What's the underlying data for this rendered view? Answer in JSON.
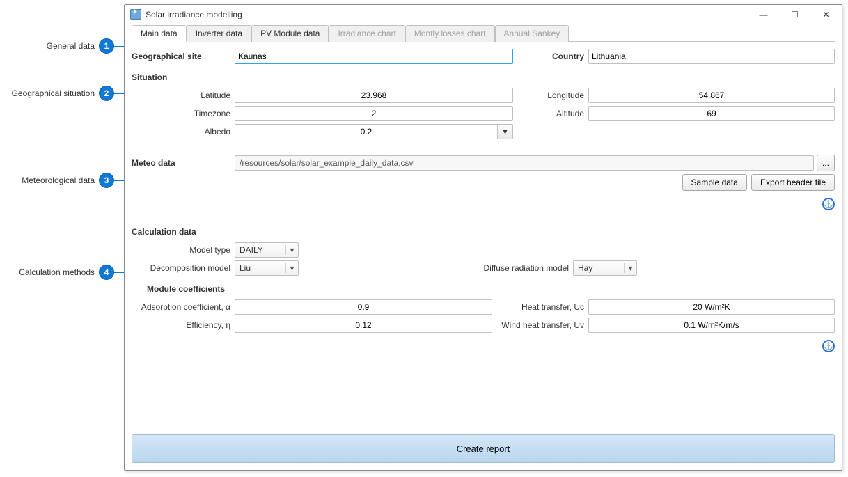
{
  "window": {
    "title": "Solar irradiance modelling"
  },
  "callouts": {
    "c1": {
      "num": "1",
      "label": "General data"
    },
    "c2": {
      "num": "2",
      "label": "Geographical situation"
    },
    "c3": {
      "num": "3",
      "label": "Meteorological data"
    },
    "c4": {
      "num": "4",
      "label": "Calculation methods"
    }
  },
  "tabs": {
    "main": "Main data",
    "inverter": "Inverter data",
    "pv": "PV Module data",
    "irr": "Irradiance chart",
    "monthly": "Montly losses chart",
    "sankey": "Annual Sankey"
  },
  "general": {
    "site_label": "Geographical site",
    "site_value": "Kaunas",
    "country_label": "Country",
    "country_value": "Lithuania"
  },
  "situation": {
    "heading": "Situation",
    "latitude_label": "Latitude",
    "latitude_value": "23.968",
    "timezone_label": "Timezone",
    "timezone_value": "2",
    "albedo_label": "Albedo",
    "albedo_value": "0.2",
    "longitude_label": "Longitude",
    "longitude_value": "54.867",
    "altitude_label": "Altitude",
    "altitude_value": "69"
  },
  "meteo": {
    "heading": "Meteo data",
    "path": "/resources/solar/solar_example_daily_data.csv",
    "browse": "...",
    "sample_btn": "Sample data",
    "export_btn": "Export header file"
  },
  "calc": {
    "heading": "Calculation data",
    "model_type_label": "Model type",
    "model_type_value": "DAILY",
    "decomp_label": "Decomposition model",
    "decomp_value": "Liu",
    "diffuse_label": "Diffuse radiation model",
    "diffuse_value": "Hay",
    "module_heading": "Module coefficients",
    "adsorp_label": "Adsorption coefficient, α",
    "adsorp_value": "0.9",
    "eff_label": "Efficiency, η",
    "eff_value": "0.12",
    "heat_label": "Heat transfer, Uc",
    "heat_value": "20 W/m²K",
    "wind_label": "Wind heat transfer, Uv",
    "wind_value": "0.1 W/m²K/m/s"
  },
  "footer": {
    "create": "Create report"
  }
}
